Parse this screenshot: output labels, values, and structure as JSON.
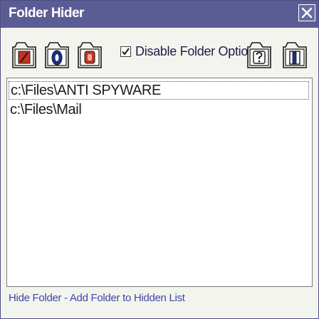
{
  "window": {
    "title": "Folder Hider"
  },
  "toolbar": {
    "buttons": [
      {
        "icon": "hide-folder-icon"
      },
      {
        "icon": "unhide-folder-icon"
      },
      {
        "icon": "lock-folder-icon"
      },
      {
        "icon": "help-folder-icon"
      },
      {
        "icon": "exit-door-icon"
      }
    ],
    "disable_option": {
      "label": "Disable Folder Option",
      "checked": true
    }
  },
  "list": {
    "items": [
      {
        "path": "c:\\Files\\ANTI SPYWARE",
        "selected": true
      },
      {
        "path": "c:\\Files\\Mail",
        "selected": false
      }
    ]
  },
  "status": {
    "text": "Hide Folder - Add Folder to Hidden List"
  },
  "colors": {
    "titlebar": "#5b5c96",
    "window_bg": "#f4f4ee",
    "status_text": "#3b47a8",
    "icon_red": "#c8321e",
    "icon_blue": "#1a2f8a"
  }
}
